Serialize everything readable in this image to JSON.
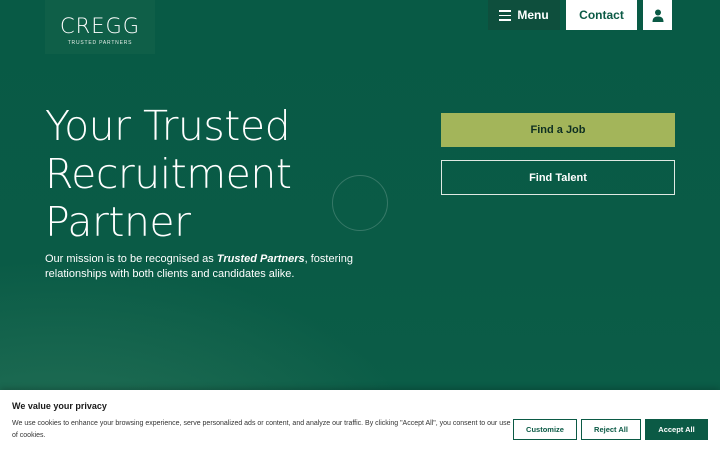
{
  "brand": {
    "name": "CREGG",
    "tagline": "TRUSTED PARTNERS",
    "primary_color": "#0b5a45",
    "accent_color": "#a3b55a"
  },
  "nav": {
    "menu_label": "Menu",
    "menu_icon": "hamburger-icon",
    "contact_label": "Contact",
    "account_icon": "user-icon"
  },
  "hero": {
    "headline": "Your Trusted Recruitment Partner",
    "mission_prefix": "Our mission is to be recognised as ",
    "mission_emphasis": "Trusted Partners",
    "mission_suffix": ", fostering relationships with both clients and candidates alike.",
    "find_job_label": "Find a Job",
    "find_talent_label": "Find Talent"
  },
  "cookie_banner": {
    "title": "We value your privacy",
    "text": "We use cookies to enhance your browsing experience, serve personalized ads or content, and analyze our traffic. By clicking \"Accept All\", you consent to our use of cookies.",
    "customize_label": "Customize",
    "reject_label": "Reject All",
    "accept_label": "Accept All"
  }
}
